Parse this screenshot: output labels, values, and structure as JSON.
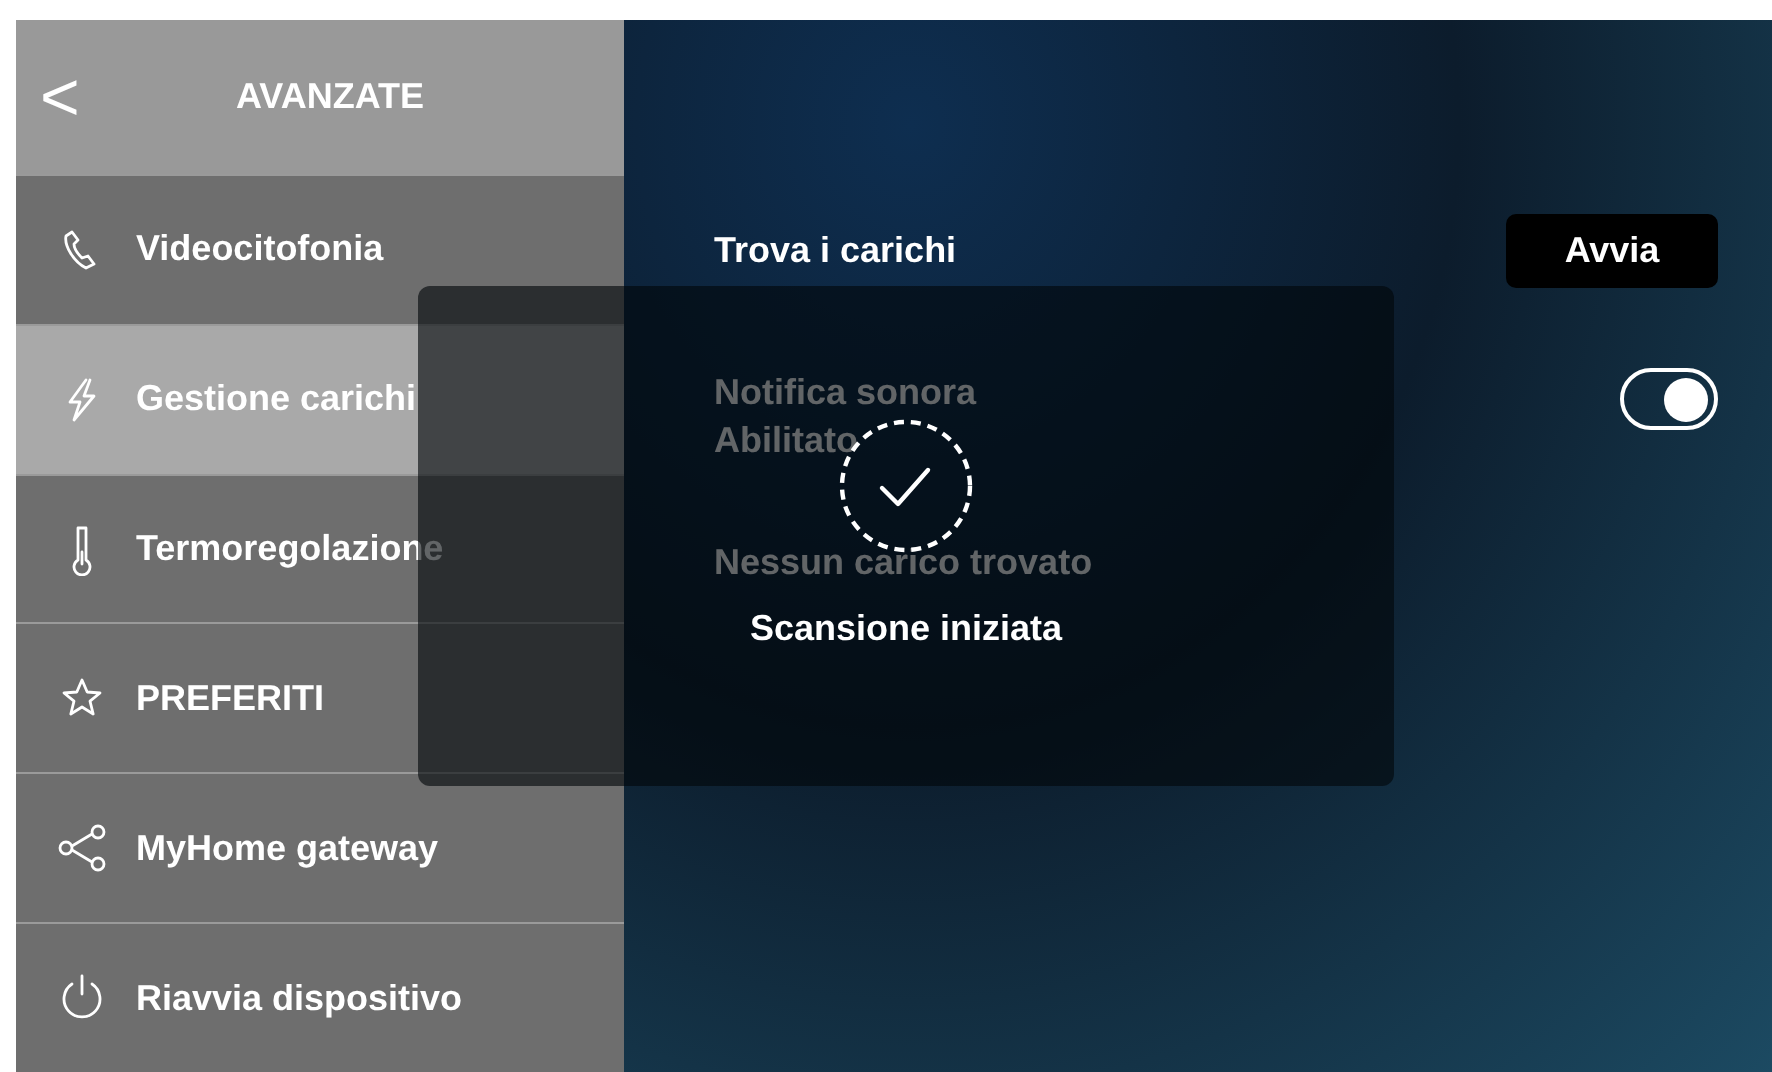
{
  "sidebar": {
    "back_label": "<",
    "title": "AVANZATE",
    "items": [
      {
        "label": "Videocitofonia",
        "selected": false
      },
      {
        "label": "Gestione carichi",
        "selected": true
      },
      {
        "label": "Termoregolazione",
        "selected": false
      },
      {
        "label": "PREFERITI",
        "selected": false
      },
      {
        "label": "MyHome gateway",
        "selected": false
      },
      {
        "label": "Riavvia dispositivo",
        "selected": false
      }
    ]
  },
  "settings": [
    {
      "kind": "button",
      "label": "Trova i carichi",
      "button": "Avvia"
    },
    {
      "kind": "toggle",
      "label": "Notifica sonora",
      "value": "Abilitato",
      "on": true
    },
    {
      "kind": "text",
      "label": "Nessun carico trovato"
    }
  ],
  "dialog": {
    "message": "Scansione iniziata"
  }
}
